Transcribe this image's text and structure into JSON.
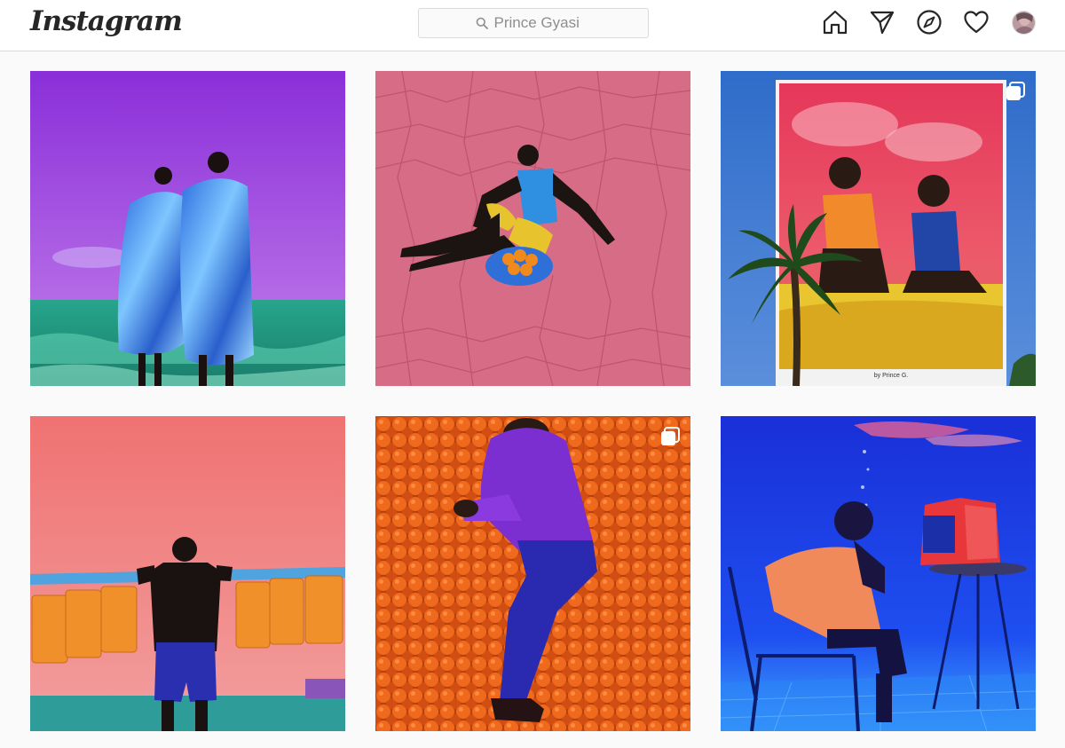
{
  "app": {
    "logo_text": "Instagram"
  },
  "search": {
    "value": "Prince Gyasi",
    "icon": "search-icon"
  },
  "nav": {
    "items": [
      {
        "icon": "home-icon"
      },
      {
        "icon": "direct-message-icon"
      },
      {
        "icon": "explore-compass-icon"
      },
      {
        "icon": "activity-heart-icon"
      },
      {
        "icon": "profile-avatar"
      }
    ]
  },
  "posts": [
    {
      "subject": "two figures wrapped in blue foil by the sea, purple sky",
      "multiple": false
    },
    {
      "subject": "man seated on pink cracked earth with basket of oranges",
      "multiple": false
    },
    {
      "subject": "billboard of two figures with palm tree",
      "multiple": true,
      "billboard_credit": "by Prince G."
    },
    {
      "subject": "man carrying pole of orange jerrycans on pink sky",
      "multiple": false
    },
    {
      "subject": "man in purple shirt lying on oranges",
      "multiple": true
    },
    {
      "subject": "man seated underwater beside red television",
      "multiple": false
    }
  ],
  "colors": {
    "header_bg": "#ffffff",
    "page_bg": "#fafafa",
    "border": "#dbdbdb",
    "icon": "#262626",
    "placeholder": "#8e8e8e"
  }
}
